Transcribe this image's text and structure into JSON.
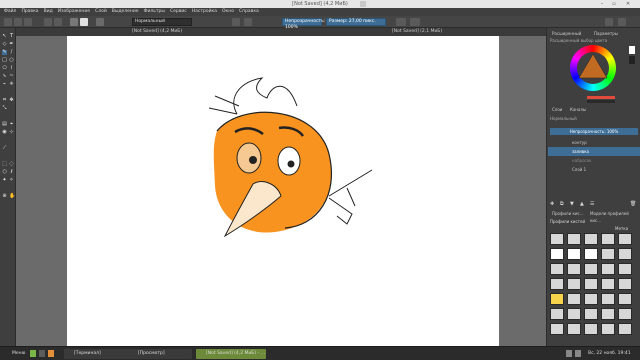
{
  "window": {
    "title": "[Not Saved] (4,2 MиБ)"
  },
  "menu": [
    "Файл",
    "Правка",
    "Вид",
    "Изображение",
    "Слой",
    "Выделение",
    "Фильтры",
    "Сервис",
    "Настройка",
    "Окно",
    "Справка"
  ],
  "toolbar": {
    "blend_mode": "Нормальный",
    "opacity_label": "Непрозрачность: 100%",
    "size_label": "Размер: 27,00 пикс."
  },
  "tabs": {
    "left": "[Not Saved] (4,2 MиБ)",
    "right": "[Not Saved] (2,1 MиБ)"
  },
  "docker": {
    "tab_advanced_color": "Расширенный",
    "tab_params": "Параметры",
    "advanced_color_title": "Расширенный выбор цвета",
    "layers_tab": "Слои",
    "channels_tab": "Каналы",
    "layer_blend": "Нормальный",
    "layer_opacity": "Непрозрачность: 100%",
    "layers": [
      {
        "name": "контур"
      },
      {
        "name": "заливка"
      },
      {
        "name": "набросок"
      },
      {
        "name": "Слой 1"
      }
    ],
    "brush_tab1": "Профили кис...",
    "brush_tab2": "Модели профилей кис...",
    "brush_title": "Профили кистей",
    "brush_filter_label": "Метка"
  },
  "taskbar": {
    "menu": "Меню",
    "terminal": "[Терминал]",
    "viewer": "[Просмотр]",
    "krita": "[Not Saved] (4,2 MиБ) - ...",
    "clock": "Вс, 22 нояб. 19:41"
  }
}
